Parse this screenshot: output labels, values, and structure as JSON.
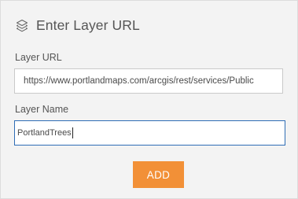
{
  "header": {
    "title": "Enter Layer URL",
    "icon": "layers-icon"
  },
  "fields": {
    "url": {
      "label": "Layer URL",
      "value": "https://www.portlandmaps.com/arcgis/rest/services/Public"
    },
    "name": {
      "label": "Layer Name",
      "value": "PortlandTrees"
    }
  },
  "actions": {
    "add_label": "ADD"
  },
  "colors": {
    "accent": "#f29037",
    "focus_border": "#2f6db5",
    "panel_bg": "#f3f3f3"
  }
}
